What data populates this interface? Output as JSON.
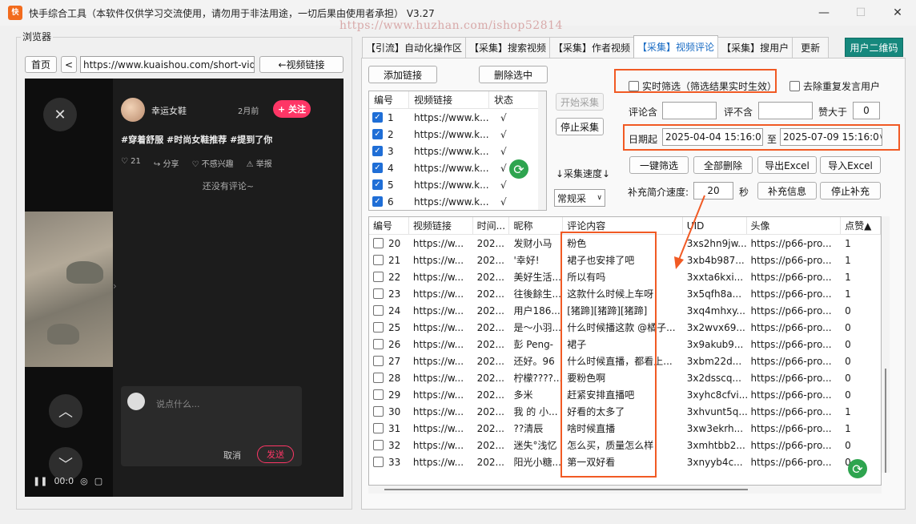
{
  "window": {
    "title": "快手综合工具（本软件仅供学习交流使用，请勿用于非法用途，一切后果由使用者承担） V3.27",
    "watermark": "https://www.huzhan.com/ishop52814",
    "min": "—",
    "max": "☐",
    "close": "✕"
  },
  "browser": {
    "group_label": "浏览器",
    "home_label": "首页",
    "back_label": "<",
    "url": "https://www.kuaishou.com/short-vide",
    "video_link_label": "←视频链接",
    "author": "幸运女鞋",
    "post_time": "2月前",
    "follow_label": "+ 关注",
    "tags": "#穿着舒服 #时尚女鞋推荐 #提到了你",
    "actions": {
      "likes": "21",
      "share": "分享",
      "not_interested": "不感兴趣",
      "report": "举报"
    },
    "no_comment": "还没有评论~",
    "comment_placeholder": "说点什么...",
    "cancel_label": "取消",
    "send_label": "发送",
    "time_readout": "00:0"
  },
  "tabs": [
    {
      "label": "【引流】自动化操作区"
    },
    {
      "label": "【采集】搜索视频"
    },
    {
      "label": "【采集】作者视频"
    },
    {
      "label": "【采集】视频评论"
    },
    {
      "label": "【采集】搜用户"
    },
    {
      "label": "更新"
    }
  ],
  "qr_label": "用户二维码",
  "controls": {
    "add_link": "添加链接",
    "delete_selected": "删除选中",
    "start_collect": "开始采集",
    "stop_collect": "停止采集",
    "speed_label": "↓采集速度↓",
    "speed_value": "常规采",
    "realtime_filter": "实时筛选（筛选结果实时生效）",
    "dedupe": "去除重复发言用户",
    "comment_contains": "评论含",
    "comment_excludes": "评不含",
    "likes_gt": "赞大于",
    "likes_gt_value": "0",
    "date_from_label": "日期起",
    "date_from": "2025-04-04 15:16:0",
    "date_to_label": "至",
    "date_to": "2025-07-09 15:16:0",
    "one_click_filter": "一键筛选",
    "delete_all": "全部删除",
    "export_excel": "导出Excel",
    "import_excel": "导入Excel",
    "supplement_speed_label": "补充简介速度:",
    "supplement_speed": "20",
    "seconds": "秒",
    "supplement_info": "补充信息",
    "stop_supplement": "停止补充"
  },
  "link_list": {
    "headers": [
      "编号",
      "视频链接",
      "状态"
    ],
    "rows": [
      {
        "id": "1",
        "link": "https://www.k...",
        "status": "√"
      },
      {
        "id": "2",
        "link": "https://www.k...",
        "status": "√"
      },
      {
        "id": "3",
        "link": "https://www.k...",
        "status": "√"
      },
      {
        "id": "4",
        "link": "https://www.k...",
        "status": "√"
      },
      {
        "id": "5",
        "link": "https://www.k...",
        "status": "√"
      },
      {
        "id": "6",
        "link": "https://www.k...",
        "status": "√"
      }
    ]
  },
  "comments_table": {
    "headers": [
      "编号",
      "视频链接",
      "时间...",
      "昵称",
      "评论内容",
      "UID",
      "头像",
      "点赞▲"
    ],
    "rows": [
      {
        "id": "20",
        "link": "https://w...",
        "time": "202...",
        "nick": "发财小马",
        "content": "粉色",
        "uid": "3xs2hn9jw...",
        "avatar": "https://p66-pro...",
        "likes": "1"
      },
      {
        "id": "21",
        "link": "https://w...",
        "time": "202...",
        "nick": "'幸好!",
        "content": "裙子也安排了吧",
        "uid": "3xb4b987...",
        "avatar": "https://p66-pro...",
        "likes": "1"
      },
      {
        "id": "22",
        "link": "https://w...",
        "time": "202...",
        "nick": "美好生活...",
        "content": "所以有吗",
        "uid": "3xxta6kxi...",
        "avatar": "https://p66-pro...",
        "likes": "1"
      },
      {
        "id": "23",
        "link": "https://w...",
        "time": "202...",
        "nick": "往後餘生...",
        "content": "这款什么时候上车呀",
        "uid": "3x5qfh8a...",
        "avatar": "https://p66-pro...",
        "likes": "1"
      },
      {
        "id": "24",
        "link": "https://w...",
        "time": "202...",
        "nick": "用户186...",
        "content": "[猪蹄][猪蹄][猪蹄]",
        "uid": "3xq4mhxy...",
        "avatar": "https://p66-pro...",
        "likes": "0"
      },
      {
        "id": "25",
        "link": "https://w...",
        "time": "202...",
        "nick": "是～小羽...",
        "content": "什么时候播这款 @橘子...",
        "uid": "3x2wvx69...",
        "avatar": "https://p66-pro...",
        "likes": "0"
      },
      {
        "id": "26",
        "link": "https://w...",
        "time": "202...",
        "nick": "彭 Peng-",
        "content": "裙子",
        "uid": "3x9akub9...",
        "avatar": "https://p66-pro...",
        "likes": "0"
      },
      {
        "id": "27",
        "link": "https://w...",
        "time": "202...",
        "nick": "还好。96",
        "content": "什么时候直播，都看上...",
        "uid": "3xbm22d...",
        "avatar": "https://p66-pro...",
        "likes": "0"
      },
      {
        "id": "28",
        "link": "https://w...",
        "time": "202...",
        "nick": "柠檬????...",
        "content": "要粉色啊",
        "uid": "3x2dsscq...",
        "avatar": "https://p66-pro...",
        "likes": "0"
      },
      {
        "id": "29",
        "link": "https://w...",
        "time": "202...",
        "nick": "多米",
        "content": "赶紧安排直播吧",
        "uid": "3xyhc8cfvi...",
        "avatar": "https://p66-pro...",
        "likes": "0"
      },
      {
        "id": "30",
        "link": "https://w...",
        "time": "202...",
        "nick": "我 的  小...",
        "content": "好看的太多了",
        "uid": "3xhvunt5q...",
        "avatar": "https://p66-pro...",
        "likes": "1"
      },
      {
        "id": "31",
        "link": "https://w...",
        "time": "202...",
        "nick": "??清辰",
        "content": "啥时候直播",
        "uid": "3xw3ekrh...",
        "avatar": "https://p66-pro...",
        "likes": "1"
      },
      {
        "id": "32",
        "link": "https://w...",
        "time": "202...",
        "nick": "迷失°浅忆",
        "content": "怎么买，质量怎么样",
        "uid": "3xmhtbb2...",
        "avatar": "https://p66-pro...",
        "likes": "0"
      },
      {
        "id": "33",
        "link": "https://w...",
        "time": "202...",
        "nick": "阳光小糖...",
        "content": "第一双好看",
        "uid": "3xnyyb4c...",
        "avatar": "https://p66-pro...",
        "likes": "0"
      }
    ]
  },
  "colors": {
    "accent_tab": "#1a6cc4",
    "qr_bg": "#16887d",
    "annotation": "#f15a24",
    "follow": "#fe3666",
    "checkbox": "#1f6ed6"
  }
}
